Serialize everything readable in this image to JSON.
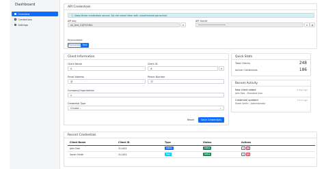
{
  "sidebar": {
    "brand": "Dashboard",
    "items": [
      {
        "label": "Overview",
        "icon": "grid-icon",
        "active": true
      },
      {
        "label": "Credentials",
        "icon": "document-icon",
        "active": false
      },
      {
        "label": "Settings",
        "icon": "gear-icon",
        "active": false
      }
    ]
  },
  "api_credentials": {
    "title": "API Credentials",
    "alert": "Keep these credentials secure. Do not share them with unauthorized personnel.",
    "api_key_label": "API Key",
    "api_key_value": "ak_test_51JP2H3Bx",
    "api_secret_label": "API Secret",
    "api_secret_value": "••••••••••••••••••••",
    "environment_label": "Environment",
    "env_production": "Production",
    "env_test": "Test"
  },
  "client_info": {
    "title": "Client Information",
    "client_name_label": "Client Name",
    "client_name_prefix": "A",
    "client_id_label": "Client ID",
    "client_id_prefix": "#",
    "email_label": "Email Address",
    "email_prefix": "@",
    "phone_label": "Phone Number",
    "phone_prefix": "☏",
    "company_label": "Company/Organization",
    "company_prefix": "⌂",
    "credential_type_label": "Credential Type",
    "credential_type_value": "Choose...",
    "reset_label": "Reset",
    "save_label": "Save Credentials"
  },
  "quick_stats": {
    "title": "Quick Stats",
    "total_clients_label": "Total Clients",
    "total_clients_value": "248",
    "active_credentials_label": "Active Credentials",
    "active_credentials_value": "186"
  },
  "recent_activity": {
    "title": "Recent Activity",
    "items": [
      {
        "title": "New client added",
        "sub": "John Doe - Standard User",
        "time": "3 days ago"
      },
      {
        "title": "Credential updated",
        "sub": "Sarah Smith - Administrator",
        "time": "1 hour ago"
      }
    ]
  },
  "recent_credentials": {
    "title": "Recent Credentials",
    "columns": [
      "Client Name",
      "Client ID",
      "Type",
      "Status",
      "Actions"
    ],
    "rows": [
      {
        "name": "John Doe",
        "id": "CLI-001",
        "type": "Admin",
        "status": "Active"
      },
      {
        "name": "Sarah Smith",
        "id": "CLI-002",
        "type": "User",
        "status": "Active"
      }
    ]
  },
  "colors": {
    "primary": "#0d6efd",
    "badge_admin": "#0d6efd",
    "badge_user": "#0dcaf0",
    "badge_active": "#198754"
  }
}
